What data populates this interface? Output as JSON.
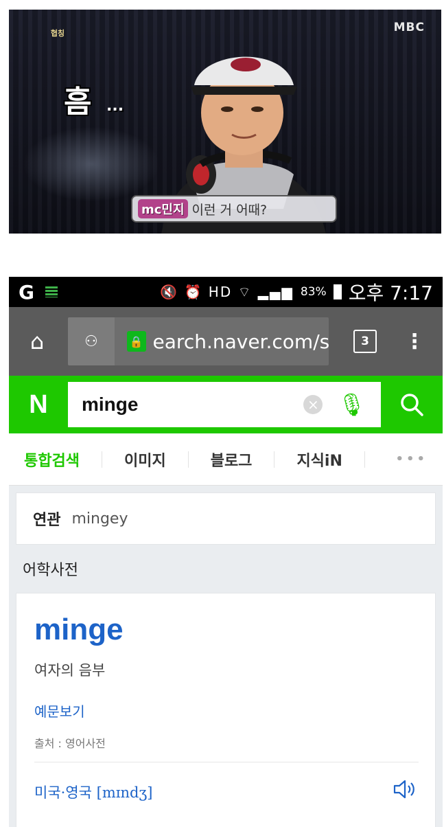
{
  "tv": {
    "channel": "MBC",
    "logo": "협칭",
    "exclaim": "흠",
    "dots": "...",
    "caption_tag": "mc민지",
    "caption_text": "이런 거 어때?"
  },
  "statusbar": {
    "battery": "83%",
    "time": "오후 7:17",
    "icons": "🔇 ⏰ HD ⌔ ▂▄▆"
  },
  "browser": {
    "url": "earch.naver.com/s",
    "tab_count": "3",
    "home_icon": "home-icon",
    "menu_icon": "more-vert-icon"
  },
  "naver": {
    "logo": "N",
    "query": "minge",
    "clear": "×",
    "mic_icon": "mic-icon",
    "search_icon": "search-icon"
  },
  "tabs": [
    {
      "label": "통합검색",
      "active": true
    },
    {
      "label": "이미지"
    },
    {
      "label": "블로그"
    },
    {
      "label": "지식iN"
    }
  ],
  "tabs_more": "•••",
  "related": {
    "label": "연관",
    "value": "mingey"
  },
  "section_title": "어학사전",
  "dict": {
    "word": "minge",
    "meaning": "여자의 음부",
    "examples_link": "예문보기",
    "source": "출처 : 영어사전",
    "pronunciation": "미국·영국 [mɪndʒ]",
    "speaker_icon": "speaker-icon"
  },
  "colors": {
    "naver_green": "#1ec800",
    "link_blue": "#1d63c8"
  }
}
